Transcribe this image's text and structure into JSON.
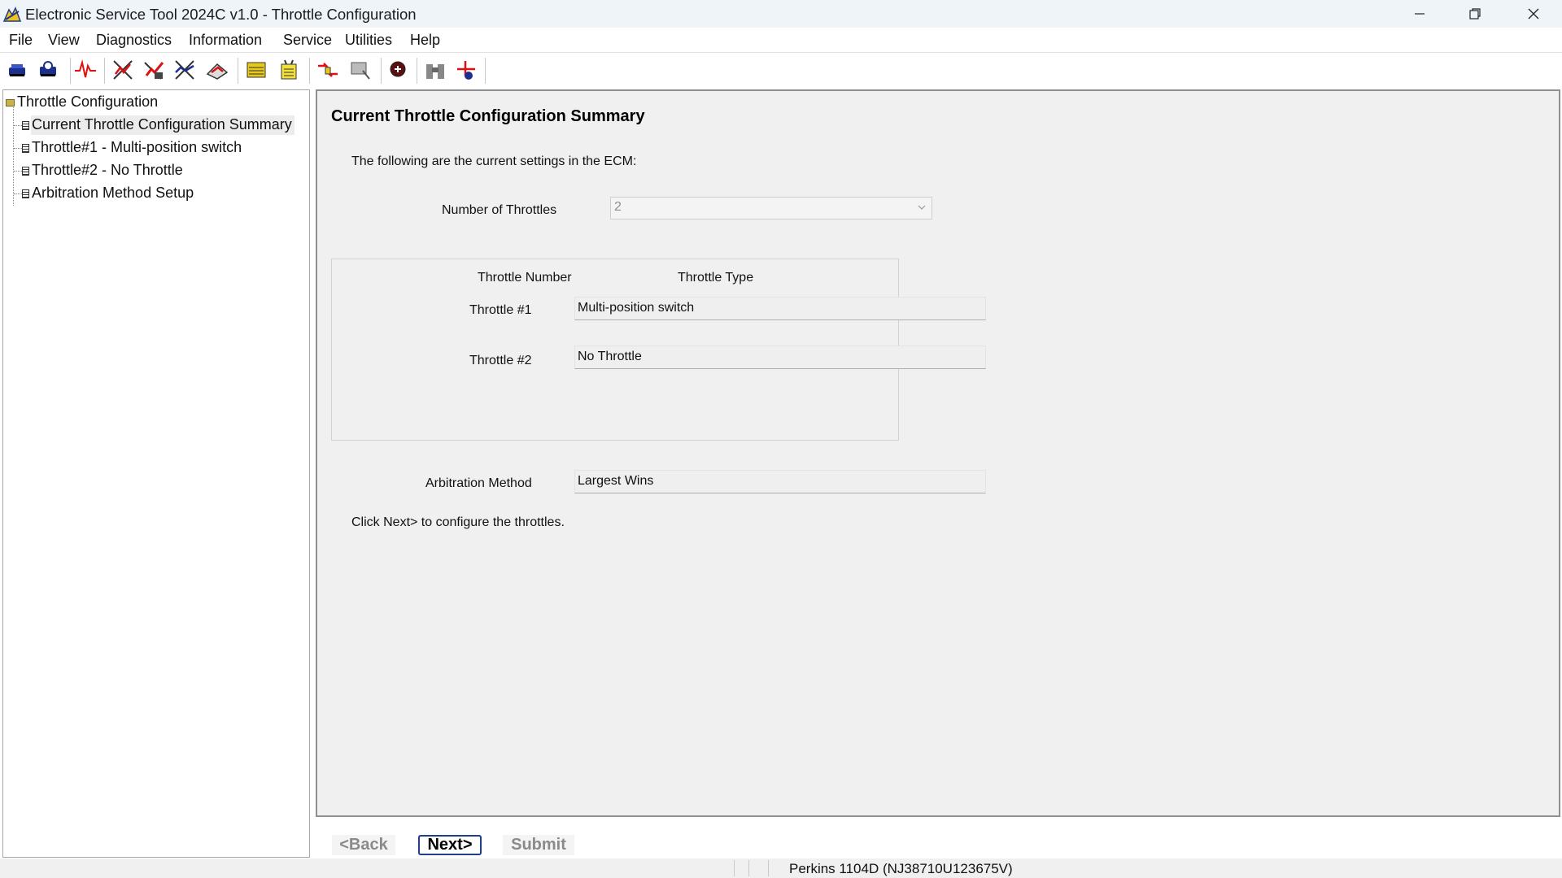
{
  "window": {
    "title": "Electronic Service Tool 2024C v1.0 - Throttle Configuration"
  },
  "menu": [
    "File",
    "View",
    "Diagnostics",
    "Information",
    "Service",
    "Utilities",
    "Help"
  ],
  "toolbar": {
    "icons": [
      "connect-icon",
      "disconnect-icon",
      "status-icon",
      "active-diagnostics-icon",
      "logged-diagnostics-icon",
      "events-icon",
      "clear-codes-icon",
      "ecm-summary-icon",
      "configuration-icon",
      "flash-icon",
      "print-icon",
      "troubleshoot-icon",
      "binoculars-icon",
      "data-link-icon"
    ]
  },
  "tree": {
    "root": "Throttle Configuration",
    "items": [
      "Current Throttle Configuration Summary",
      "Throttle#1 - Multi-position switch",
      "Throttle#2 - No Throttle",
      "Arbitration Method Setup"
    ],
    "selected_index": 0
  },
  "content": {
    "title": "Current Throttle Configuration Summary",
    "intro": "The following are the current settings in the ECM:",
    "number_of_throttles_label": "Number of Throttles",
    "number_of_throttles_value": "2",
    "col_throttle_number": "Throttle Number",
    "col_throttle_type": "Throttle Type",
    "throttles": [
      {
        "label": "Throttle #1",
        "type": "Multi-position switch"
      },
      {
        "label": "Throttle #2",
        "type": "No Throttle"
      }
    ],
    "arbitration_label": "Arbitration Method",
    "arbitration_value": "Largest Wins",
    "hint": "Click Next> to configure the throttles."
  },
  "wizard": {
    "back": "<Back",
    "next": "Next>",
    "submit": "Submit"
  },
  "status": {
    "ecm": "Perkins 1104D (NJ38710U123675V)"
  }
}
